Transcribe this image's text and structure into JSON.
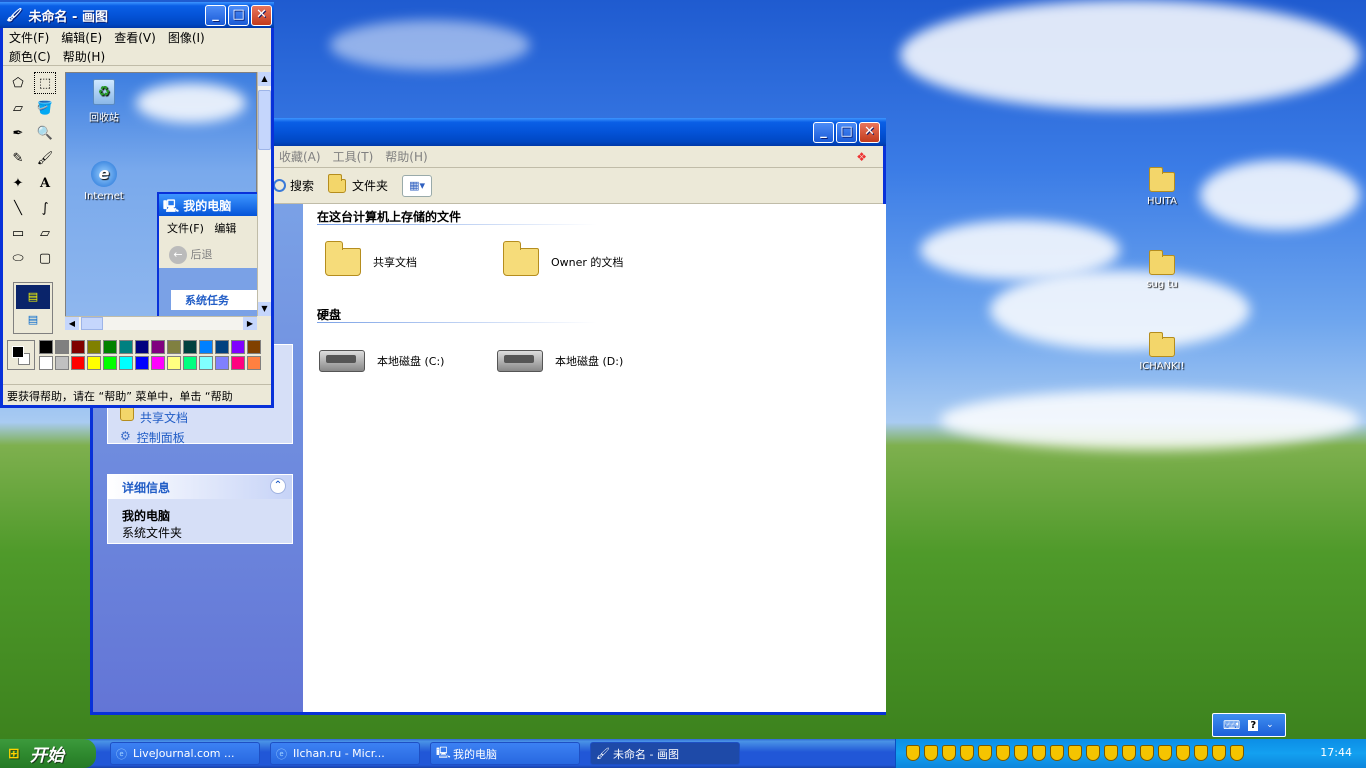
{
  "desktop": {
    "icons": [
      {
        "label": "HUITA"
      },
      {
        "label": "sug tu"
      },
      {
        "label": "ICHANKI!"
      }
    ]
  },
  "mycomputer": {
    "title": "我的电脑",
    "menu": [
      "收藏(A)",
      "工具(T)",
      "帮助(H)"
    ],
    "toolbar": {
      "search": "搜索",
      "folders": "文件夹"
    },
    "section_files": "在这台计算机上存储的文件",
    "shared_docs": "共享文档",
    "owner_docs": "Owner 的文档",
    "section_disks": "硬盘",
    "disk_c": "本地磁盘 (C:)",
    "disk_d": "本地磁盘 (D:)",
    "links": [
      "共享文档",
      "控制面板"
    ],
    "details_title": "详细信息",
    "details_name": "我的电脑",
    "details_type": "系统文件夹"
  },
  "small_mycomputer": {
    "title": "我的电脑",
    "menu": [
      "文件(F)",
      "编辑"
    ],
    "back": "后退",
    "task_header": "系统任务"
  },
  "paint": {
    "title": "未命名 - 画图",
    "menu_row1": [
      "文件(F)",
      "编辑(E)",
      "查看(V)",
      "图像(I)"
    ],
    "menu_row2": [
      "颜色(C)",
      "帮助(H)"
    ],
    "canvas_icons": [
      {
        "label": "回收站"
      },
      {
        "label": "Internet"
      }
    ],
    "status": "要获得帮助，请在 “帮助” 菜单中，单击 “帮助",
    "palette_row1": [
      "#000000",
      "#808080",
      "#800000",
      "#808000",
      "#008000",
      "#008080",
      "#000080",
      "#800080",
      "#808040",
      "#004040",
      "#0080ff",
      "#004080",
      "#8000ff",
      "#804000"
    ],
    "palette_row2": [
      "#ffffff",
      "#c0c0c0",
      "#ff0000",
      "#ffff00",
      "#00ff00",
      "#00ffff",
      "#0000ff",
      "#ff00ff",
      "#ffff80",
      "#00ff80",
      "#80ffff",
      "#8080ff",
      "#ff0080",
      "#ff8040"
    ]
  },
  "taskbar": {
    "start": "开始",
    "tasks": [
      "LiveJournal.com ...",
      "IIchan.ru - Micr...",
      "我的电脑",
      "未命名 - 画图"
    ],
    "clock": "17:44"
  }
}
